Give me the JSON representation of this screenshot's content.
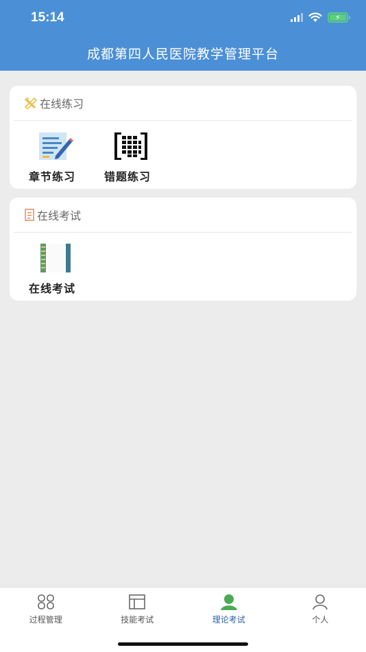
{
  "status": {
    "time": "15:14"
  },
  "header": {
    "title": "成都第四人民医院教学管理平台"
  },
  "sections": [
    {
      "title": "在线练习",
      "icon": "pencil-ruler-icon",
      "items": [
        {
          "label": "章节练习",
          "icon": "chapter-notes-icon"
        },
        {
          "label": "错题练习",
          "icon": "wrong-questions-icon"
        }
      ]
    },
    {
      "title": "在线考试",
      "icon": "exam-paper-icon",
      "items": [
        {
          "label": "在线考试",
          "icon": "exam-book-icon"
        }
      ]
    }
  ],
  "tabbar": {
    "tabs": [
      {
        "label": "过程管理",
        "icon": "process-grid-icon",
        "active": false
      },
      {
        "label": "技能考试",
        "icon": "skill-panel-icon",
        "active": false
      },
      {
        "label": "理论考试",
        "icon": "theory-person-icon",
        "active": true
      },
      {
        "label": "个人",
        "icon": "user-icon",
        "active": false
      }
    ]
  },
  "colors": {
    "header": "#4b8fd6",
    "active_tab": "#2f62a8",
    "active_icon": "#4caa55"
  }
}
